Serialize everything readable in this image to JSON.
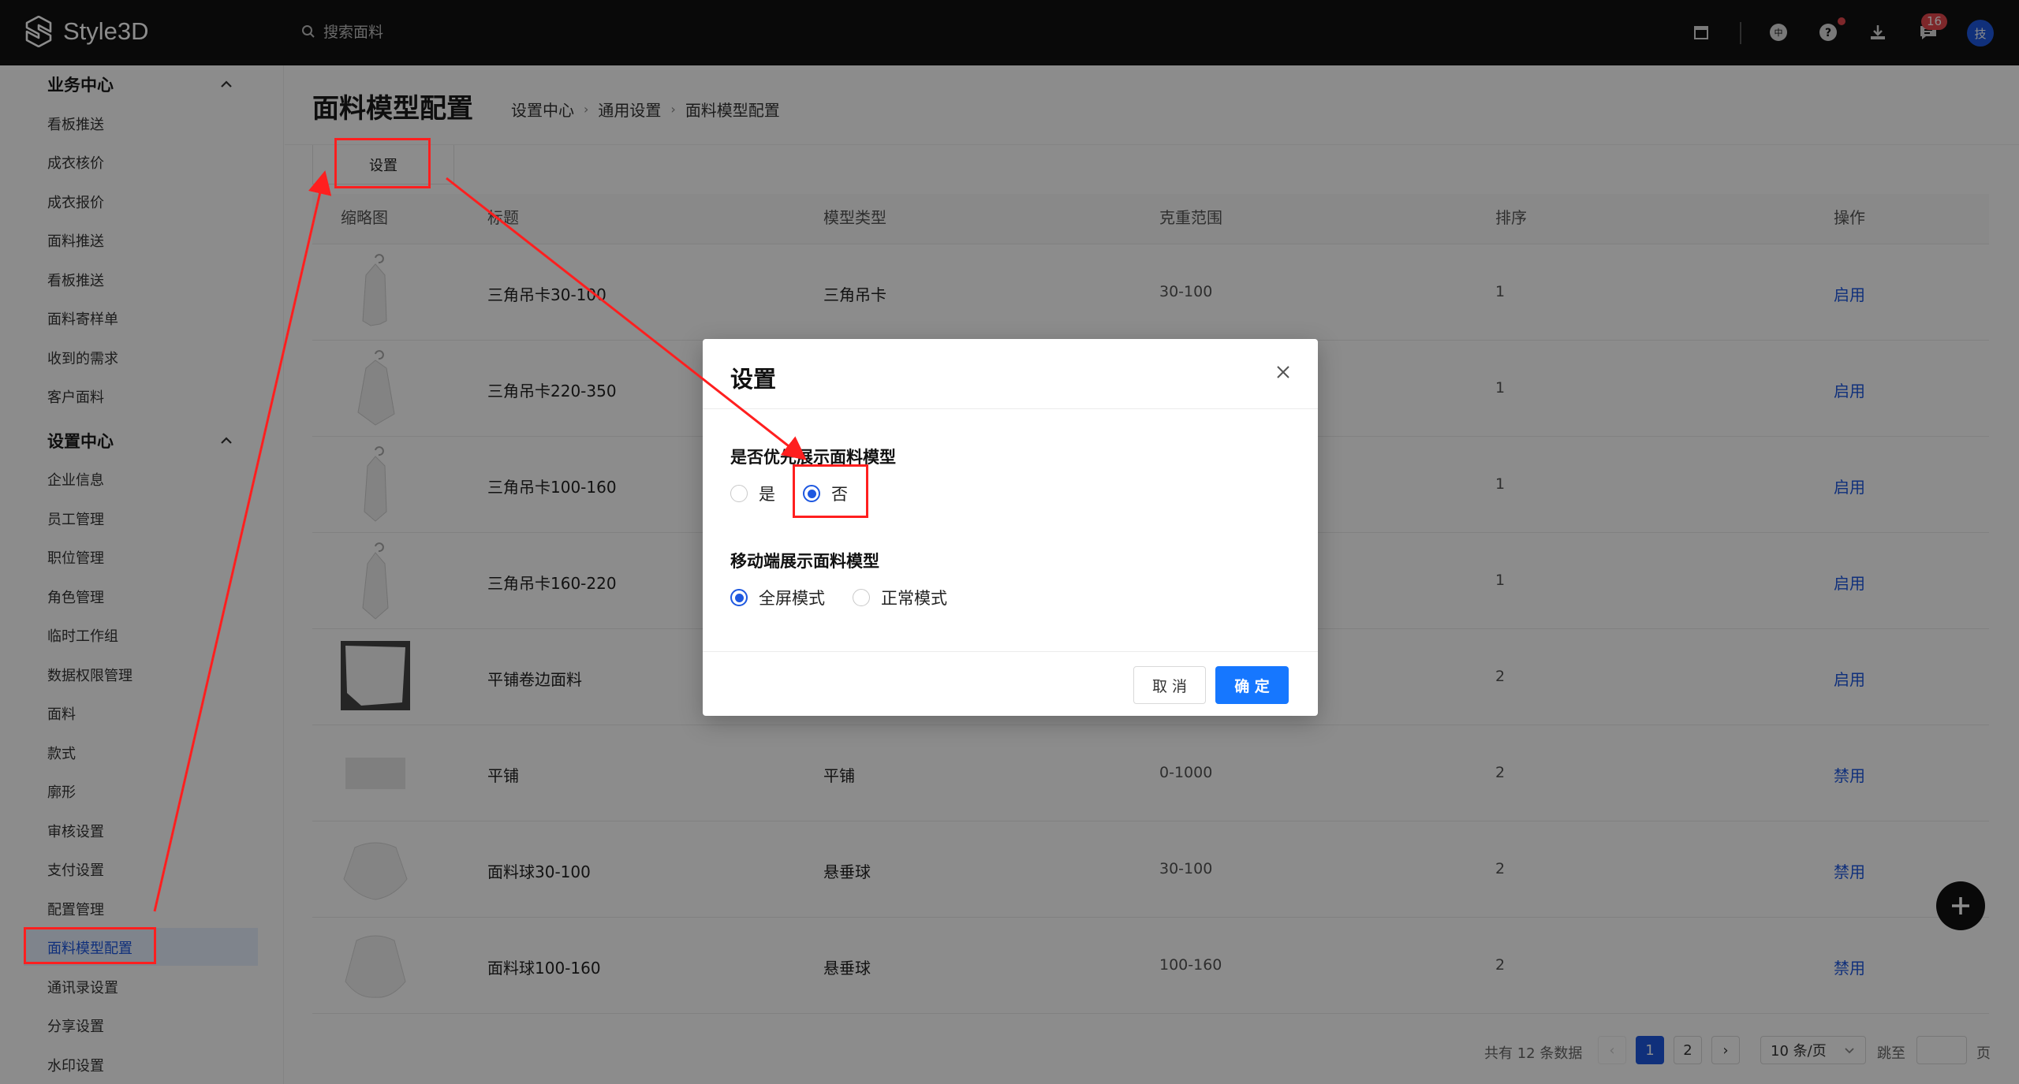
{
  "header": {
    "brand": "Style3D",
    "search_placeholder": "搜索面料",
    "message_badge": "16",
    "avatar_text": "技"
  },
  "sidebar": {
    "groups": [
      {
        "label": "业务中心",
        "items": [
          "看板推送",
          "成衣核价",
          "成衣报价",
          "面料推送",
          "看板推送",
          "面料寄样单",
          "收到的需求",
          "客户面料"
        ]
      },
      {
        "label": "设置中心",
        "items": [
          "企业信息",
          "员工管理",
          "职位管理",
          "角色管理",
          "临时工作组",
          "数据权限管理",
          "面料",
          "款式",
          "廓形",
          "审核设置",
          "支付设置",
          "配置管理",
          "面料模型配置",
          "通讯录设置",
          "分享设置",
          "水印设置"
        ]
      }
    ],
    "active_item": "面料模型配置"
  },
  "page": {
    "title": "面料模型配置",
    "breadcrumb": [
      "设置中心",
      "通用设置",
      "面料模型配置"
    ],
    "tab_label": "设置"
  },
  "table": {
    "columns": [
      "缩略图",
      "标题",
      "模型类型",
      "克重范围",
      "排序",
      "操作"
    ],
    "rows": [
      {
        "title": "三角吊卡30-100",
        "type": "三角吊卡",
        "range": "30-100",
        "order": "1",
        "action": "启用"
      },
      {
        "title": "三角吊卡220-350",
        "type": "",
        "range": "",
        "order": "1",
        "action": "启用"
      },
      {
        "title": "三角吊卡100-160",
        "type": "",
        "range": "",
        "order": "1",
        "action": "启用"
      },
      {
        "title": "三角吊卡160-220",
        "type": "",
        "range": "",
        "order": "1",
        "action": "启用"
      },
      {
        "title": "平铺卷边面料",
        "type": "",
        "range": "",
        "order": "2",
        "action": "启用"
      },
      {
        "title": "平铺",
        "type": "平铺",
        "range": "0-1000",
        "order": "2",
        "action": "禁用"
      },
      {
        "title": "面料球30-100",
        "type": "悬垂球",
        "range": "30-100",
        "order": "2",
        "action": "禁用"
      },
      {
        "title": "面料球100-160",
        "type": "悬垂球",
        "range": "100-160",
        "order": "2",
        "action": "禁用"
      }
    ]
  },
  "pagination": {
    "total": "共有 12 条数据",
    "pages": [
      "1",
      "2"
    ],
    "current": "1",
    "page_size": "10 条/页",
    "jump_label": "跳至",
    "page_unit": "页"
  },
  "modal": {
    "title": "设置",
    "field1": {
      "label": "是否优先展示面料模型",
      "options": [
        "是",
        "否"
      ],
      "selected": "否"
    },
    "field2": {
      "label": "移动端展示面料模型",
      "options": [
        "全屏模式",
        "正常模式"
      ],
      "selected": "全屏模式"
    },
    "cancel": "取 消",
    "ok": "确 定"
  },
  "colors": {
    "accent": "#1e58e0",
    "primary_button": "#1677ff",
    "annotation": "#ff1f1f",
    "topbar": "#111111"
  }
}
